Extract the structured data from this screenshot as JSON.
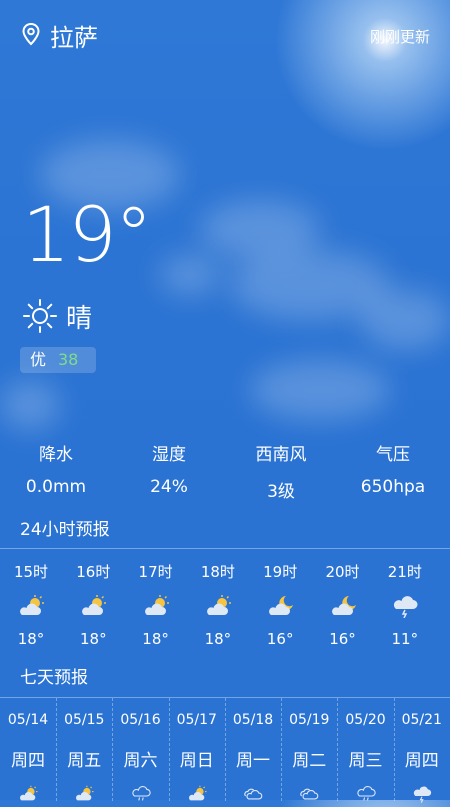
{
  "header": {
    "city": "拉萨",
    "updated": "刚刚更新"
  },
  "current": {
    "temperature": "19°",
    "condition": "晴",
    "aqi_label": "优",
    "aqi_value": "38"
  },
  "stats": [
    {
      "label": "降水",
      "value": "0.0mm"
    },
    {
      "label": "湿度",
      "value": "24%"
    },
    {
      "label": "西南风",
      "value": "3级"
    },
    {
      "label": "气压",
      "value": "650hpa"
    }
  ],
  "hourly_title": "24小时预报",
  "hourly": [
    {
      "time": "15时",
      "icon": "partly-cloudy-sun-icon",
      "temp": "18°"
    },
    {
      "time": "16时",
      "icon": "partly-cloudy-sun-icon",
      "temp": "18°"
    },
    {
      "time": "17时",
      "icon": "partly-cloudy-sun-icon",
      "temp": "18°"
    },
    {
      "time": "18时",
      "icon": "partly-cloudy-sun-icon",
      "temp": "18°"
    },
    {
      "time": "19时",
      "icon": "partly-cloudy-moon-icon",
      "temp": "16°"
    },
    {
      "time": "20时",
      "icon": "partly-cloudy-moon-icon",
      "temp": "16°"
    },
    {
      "time": "21时",
      "icon": "thunderstorm-icon",
      "temp": "11°"
    }
  ],
  "daily_title": "七天预报",
  "daily": [
    {
      "date": "05/14",
      "weekday": "周四",
      "icon": "partly-cloudy-sun-icon"
    },
    {
      "date": "05/15",
      "weekday": "周五",
      "icon": "partly-cloudy-sun-icon"
    },
    {
      "date": "05/16",
      "weekday": "周六",
      "icon": "rain-icon"
    },
    {
      "date": "05/17",
      "weekday": "周日",
      "icon": "partly-cloudy-sun-icon"
    },
    {
      "date": "05/18",
      "weekday": "周一",
      "icon": "cloudy-icon"
    },
    {
      "date": "05/19",
      "weekday": "周二",
      "icon": "cloudy-icon"
    },
    {
      "date": "05/20",
      "weekday": "周三",
      "icon": "rain-icon"
    },
    {
      "date": "05/21",
      "weekday": "周四",
      "icon": "thunderstorm-icon"
    }
  ]
}
